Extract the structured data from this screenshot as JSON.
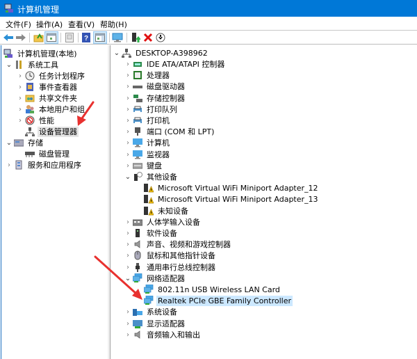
{
  "window": {
    "title": "计算机管理",
    "app_icon": "computer-management-icon"
  },
  "menu": [
    "文件(F)",
    "操作(A)",
    "查看(V)",
    "帮助(H)"
  ],
  "toolbar": [
    {
      "name": "back-button",
      "icon": "arrow-left-icon"
    },
    {
      "name": "forward-button",
      "icon": "arrow-right-icon"
    },
    {
      "name": "up-folder-button",
      "icon": "folder-up-icon"
    },
    {
      "name": "show-hide-tree-button",
      "icon": "console-tree-icon"
    },
    {
      "name": "properties-button",
      "icon": "properties-icon"
    },
    {
      "name": "help-button",
      "icon": "help-icon"
    },
    {
      "name": "show-action-pane-button",
      "icon": "action-pane-icon"
    },
    {
      "name": "scan-hardware-button",
      "icon": "monitor-scan-icon"
    },
    {
      "name": "update-driver-button",
      "icon": "update-driver-icon"
    },
    {
      "name": "uninstall-device-button",
      "icon": "red-x-icon"
    },
    {
      "name": "disable-device-button",
      "icon": "down-circle-icon"
    }
  ],
  "left_tree": {
    "root": "计算机管理(本地)",
    "items": [
      {
        "label": "系统工具",
        "level": 1,
        "expanded": true,
        "icon": "tools-icon"
      },
      {
        "label": "任务计划程序",
        "level": 2,
        "icon": "clock-icon"
      },
      {
        "label": "事件查看器",
        "level": 2,
        "icon": "event-viewer-icon"
      },
      {
        "label": "共享文件夹",
        "level": 2,
        "icon": "shared-folder-icon"
      },
      {
        "label": "本地用户和组",
        "level": 2,
        "icon": "users-icon"
      },
      {
        "label": "性能",
        "level": 2,
        "icon": "performance-icon"
      },
      {
        "label": "设备管理器",
        "level": 2,
        "icon": "device-manager-icon",
        "selected": true
      },
      {
        "label": "存储",
        "level": 1,
        "expanded": true,
        "icon": "storage-icon"
      },
      {
        "label": "磁盘管理",
        "level": 2,
        "icon": "disk-icon"
      },
      {
        "label": "服务和应用程序",
        "level": 1,
        "icon": "services-icon"
      }
    ]
  },
  "device_tree": {
    "root": "DESKTOP-A398962",
    "items": [
      {
        "label": "IDE ATA/ATAPI 控制器",
        "icon": "ide-controller-icon"
      },
      {
        "label": "处理器",
        "icon": "processor-icon"
      },
      {
        "label": "磁盘驱动器",
        "icon": "disk-drive-icon"
      },
      {
        "label": "存储控制器",
        "icon": "storage-controller-icon"
      },
      {
        "label": "打印队列",
        "icon": "print-queue-icon"
      },
      {
        "label": "打印机",
        "icon": "printer-icon"
      },
      {
        "label": "端口 (COM 和 LPT)",
        "icon": "port-icon"
      },
      {
        "label": "计算机",
        "icon": "computer-icon"
      },
      {
        "label": "监视器",
        "icon": "monitor-icon"
      },
      {
        "label": "键盘",
        "icon": "keyboard-icon"
      },
      {
        "label": "其他设备",
        "icon": "other-devices-icon",
        "expanded": true,
        "children": [
          {
            "label": "Microsoft Virtual WiFi Miniport Adapter_12",
            "icon": "warning-device-icon"
          },
          {
            "label": "Microsoft Virtual WiFi Miniport Adapter_13",
            "icon": "warning-device-icon"
          },
          {
            "label": "未知设备",
            "icon": "warning-device-icon"
          }
        ]
      },
      {
        "label": "人体学输入设备",
        "icon": "hid-icon"
      },
      {
        "label": "软件设备",
        "icon": "software-device-icon"
      },
      {
        "label": "声音、视频和游戏控制器",
        "icon": "speaker-icon"
      },
      {
        "label": "鼠标和其他指针设备",
        "icon": "mouse-icon"
      },
      {
        "label": "通用串行总线控制器",
        "icon": "usb-icon"
      },
      {
        "label": "网络适配器",
        "icon": "network-adapter-icon",
        "expanded": true,
        "children": [
          {
            "label": "802.11n USB Wireless LAN Card",
            "icon": "network-adapter-icon"
          },
          {
            "label": "Realtek PCIe GBE Family Controller",
            "icon": "network-adapter-icon",
            "selected": true
          }
        ]
      },
      {
        "label": "系统设备",
        "icon": "system-devices-icon"
      },
      {
        "label": "显示适配器",
        "icon": "display-adapter-icon"
      },
      {
        "label": "音频输入和输出",
        "icon": "audio-io-icon"
      }
    ]
  },
  "annotations": [
    {
      "name": "red-arrow-to-device-manager",
      "color": "#e8312f"
    },
    {
      "name": "red-arrow-to-realtek",
      "color": "#e8312f"
    }
  ]
}
